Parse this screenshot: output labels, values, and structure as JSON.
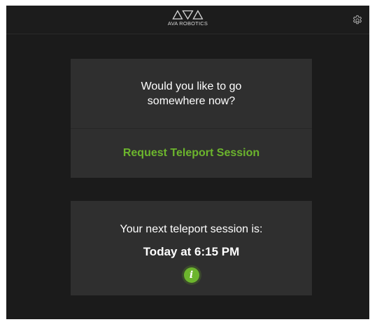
{
  "header": {
    "brand": "AVA ROBOTICS",
    "settings_icon": "gear-icon"
  },
  "go_card": {
    "question": "Would you like to go somewhere now?",
    "action_label": "Request Teleport Session"
  },
  "next_card": {
    "label": "Your next teleport session is:",
    "time": "Today at 6:15 PM",
    "info_icon_glyph": "i"
  },
  "colors": {
    "background": "#1b1b1b",
    "card": "#2f2f2f",
    "accent": "#6cb52d",
    "text": "#ffffff"
  }
}
